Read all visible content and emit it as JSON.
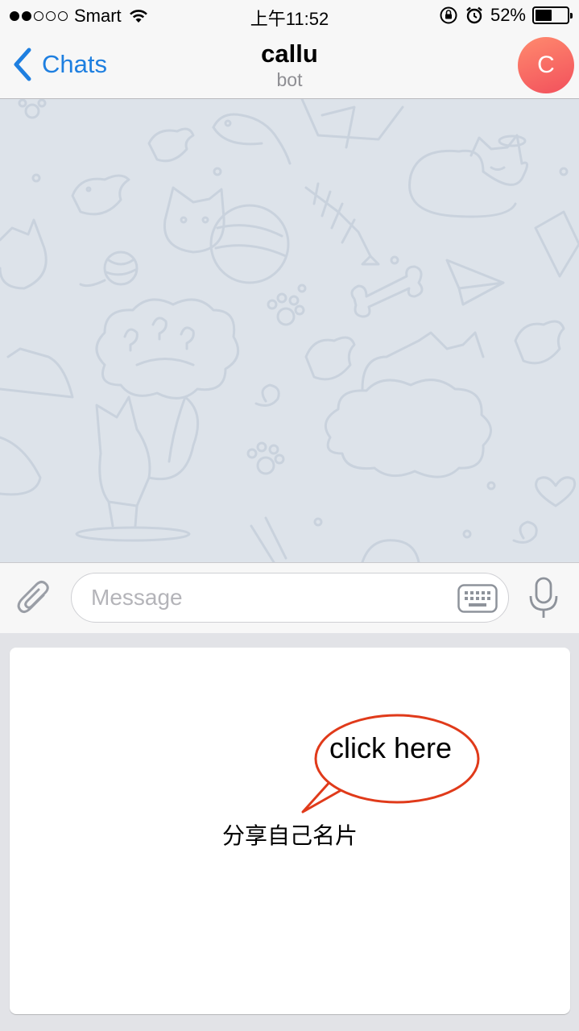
{
  "status_bar": {
    "carrier": "Smart",
    "time": "上午11:52",
    "battery_percent": "52%",
    "battery_level": 0.52,
    "signal_bars_filled": 2,
    "signal_bars_total": 5
  },
  "nav": {
    "back_label": "Chats",
    "title": "callu",
    "subtitle": "bot",
    "avatar_initial": "C"
  },
  "composer": {
    "placeholder": "Message"
  },
  "bot_keyboard": {
    "button_label": "分享自己名片"
  },
  "annotation": {
    "callout_text": "click here",
    "color": "#e03a1a"
  },
  "colors": {
    "accent": "#1e7fe0",
    "avatar_start": "#ff8a6e",
    "avatar_end": "#f2505c",
    "chat_background": "#dde3ea"
  },
  "icons": {
    "back": "chevron-left-icon",
    "attach": "paperclip-icon",
    "keyboard": "keyboard-icon",
    "mic": "microphone-icon",
    "wifi": "wifi-icon",
    "rotation_lock": "rotation-lock-icon",
    "alarm": "alarm-icon"
  }
}
